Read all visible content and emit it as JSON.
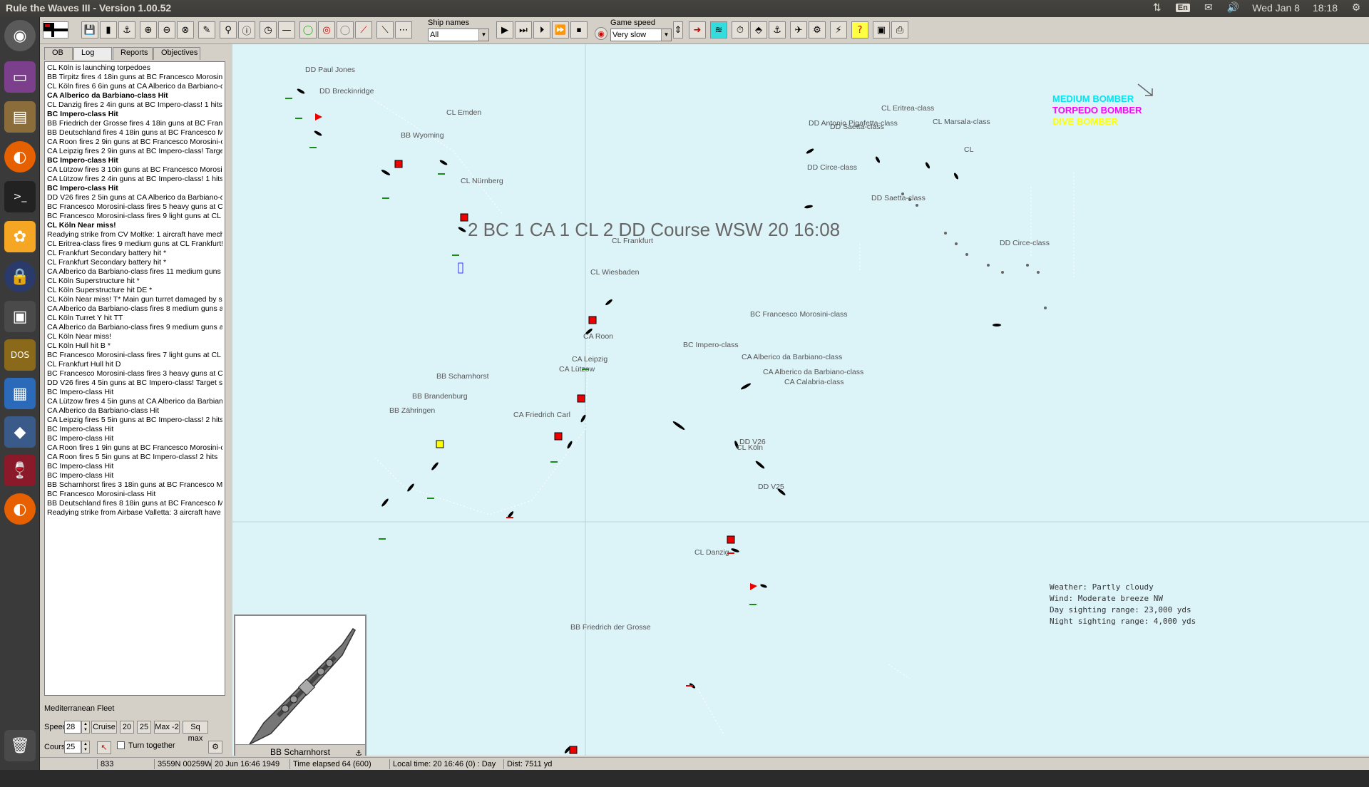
{
  "panel": {
    "title": "Rule the Waves III - Version 1.00.52",
    "lang": "En",
    "date": "Wed Jan 8",
    "time": "18:18"
  },
  "launcher": {
    "items": [
      "dash-home",
      "files",
      "file-manager",
      "firefox",
      "terminal",
      "app-store",
      "lock",
      "window",
      "dosbox",
      "writer",
      "virtualbox",
      "wine",
      "firefox-2",
      "trash"
    ]
  },
  "toolbar": {
    "ship_names_label": "Ship names",
    "ship_names_value": "All",
    "game_speed_label": "Game speed",
    "game_speed_value": "Very slow"
  },
  "tabs": [
    "OB",
    "Log",
    "Reports",
    "Objectives"
  ],
  "log": [
    {
      "t": "CL Köln is launching torpedoes",
      "b": false
    },
    {
      "t": "BB Tirpitz fires 4 18in guns at BC Francesco Morosini",
      "b": false
    },
    {
      "t": "CL Köln fires 6 6in guns at CA Alberico da Barbiano-c",
      "b": false
    },
    {
      "t": "CA Alberico da Barbiano-class Hit",
      "b": true
    },
    {
      "t": "CL Danzig fires 2 4in guns at BC Impero-class! 1 hits",
      "b": false
    },
    {
      "t": "BC Impero-class Hit",
      "b": true
    },
    {
      "t": "BB Friedrich der Grosse fires 4 18in guns at BC Franc",
      "b": false
    },
    {
      "t": "BB Deutschland fires 4 18in guns at BC Francesco M",
      "b": false
    },
    {
      "t": "CA Roon fires 2 9in guns at BC Francesco Morosini-c",
      "b": false
    },
    {
      "t": "CA Leipzig fires 2 9in guns at BC Impero-class! Targe",
      "b": false
    },
    {
      "t": "BC Impero-class Hit",
      "b": true
    },
    {
      "t": "CA Lützow fires 3 10in guns at BC Francesco Morosi",
      "b": false
    },
    {
      "t": "CA Lützow fires 2 4in guns at BC Impero-class! 1 hits",
      "b": false
    },
    {
      "t": "BC Impero-class Hit",
      "b": true
    },
    {
      "t": "DD V26 fires 2 5in guns at CA Alberico da Barbiano-c",
      "b": false
    },
    {
      "t": "BC Francesco Morosini-class fires 5 heavy guns at C",
      "b": false
    },
    {
      "t": "BC Francesco Morosini-class fires 9 light guns at CL I",
      "b": false
    },
    {
      "t": "CL Köln Near miss!",
      "b": true
    },
    {
      "t": "Readying strike from CV Moltke: 1 aircraft have mech",
      "b": false
    },
    {
      "t": "CL Eritrea-class fires 9 medium guns at CL Frankfurt!",
      "b": false
    },
    {
      "t": "CL Frankfurt Secondary battery hit *",
      "b": false
    },
    {
      "t": "CL Frankfurt Secondary battery hit *",
      "b": false
    },
    {
      "t": "CA Alberico da Barbiano-class fires 11 medium guns",
      "b": false
    },
    {
      "t": "CL Köln Superstructure hit *",
      "b": false
    },
    {
      "t": "CL Köln Superstructure hit DE *",
      "b": false
    },
    {
      "t": "CL Köln Near miss! T* Main gun turret damaged by sp",
      "b": false
    },
    {
      "t": "CA Alberico da Barbiano-class fires 8 medium guns at",
      "b": false
    },
    {
      "t": "CL Köln Turret Y hit TT",
      "b": false
    },
    {
      "t": "CA Alberico da Barbiano-class fires 9 medium guns at",
      "b": false
    },
    {
      "t": "CL Köln Near miss!",
      "b": false
    },
    {
      "t": "CL Köln Hull hit B *",
      "b": false
    },
    {
      "t": "BC Francesco Morosini-class fires 7 light guns at CL F",
      "b": false
    },
    {
      "t": "CL Frankfurt Hull hit D",
      "b": false
    },
    {
      "t": "BC Francesco Morosini-class fires 3 heavy guns at C",
      "b": false
    },
    {
      "t": "DD V26 fires 4 5in guns at BC Impero-class! Target s",
      "b": false
    },
    {
      "t": "BC Impero-class Hit",
      "b": false
    },
    {
      "t": "CA Lützow fires 4 5in guns at CA Alberico da Barbian",
      "b": false
    },
    {
      "t": "CA Alberico da Barbiano-class Hit",
      "b": false
    },
    {
      "t": "CA Leipzig fires 5 5in guns at BC Impero-class! 2 hits",
      "b": false
    },
    {
      "t": "BC Impero-class Hit",
      "b": false
    },
    {
      "t": "BC Impero-class Hit",
      "b": false
    },
    {
      "t": "CA Roon fires 1 9in guns at BC Francesco Morosini-c",
      "b": false
    },
    {
      "t": "CA Roon fires 5 5in guns at BC Impero-class! 2 hits",
      "b": false
    },
    {
      "t": "BC Impero-class Hit",
      "b": false
    },
    {
      "t": "BC Impero-class Hit",
      "b": false
    },
    {
      "t": "BB Scharnhorst fires 3 18in guns at BC Francesco M",
      "b": false
    },
    {
      "t": "BC Francesco Morosini-class Hit",
      "b": false
    },
    {
      "t": "BB Deutschland fires 8 18in guns at BC Francesco M",
      "b": false
    },
    {
      "t": "Readying strike from Airbase Valletta: 3 aircraft have",
      "b": false
    }
  ],
  "fleet": {
    "name": "Mediterranean Fleet",
    "speed_label": "Speed",
    "speed_value": "28",
    "cruise": "Cruise",
    "s20": "20",
    "s25": "25",
    "max2": "Max -2",
    "sqmax": "Sq max",
    "course_label": "Course",
    "course_value": "25",
    "turn_together": "Turn together"
  },
  "map": {
    "group_info": "2 BC 1 CA 1 CL 2 DD Course WSW 20 16:08",
    "legend": [
      {
        "label": "MEDIUM BOMBER",
        "color": "#00e5f0"
      },
      {
        "label": "TORPEDO BOMBER",
        "color": "#ff00ff"
      },
      {
        "label": "DIVE BOMBER",
        "color": "#ffff00"
      }
    ],
    "weather": [
      "Weather: Partly cloudy",
      "Wind: Moderate breeze  NW",
      "Day sighting range: 23,000 yds",
      "Night sighting range: 4,000 yds"
    ],
    "labels": [
      "DD Paul Jones",
      "DD Breckinridge",
      "BB Wyoming",
      "CL Emden",
      "CL Nürnberg",
      "CL Frankfurt",
      "CL Wiesbaden",
      "CA Roon",
      "CA Leipzig",
      "CA Lützow",
      "BB Scharnhorst",
      "BB Brandenburg",
      "BB Zähringen",
      "CA Friedrich Carl",
      "DD V26",
      "CL Köln",
      "DD V25",
      "CL Danzig",
      "BB Friedrich der Grosse",
      "BC Francesco Morosini-class",
      "BC Impero-class",
      "CA Alberico da Barbiano-class",
      "CA Alberico da Barbiano-class",
      "CA Calabria-class",
      "CL Eritrea-class",
      "CL Marsala-class",
      "DD Antonio Pigafetta-class",
      "DD Saetta-class",
      "CL",
      "DD Circe-class",
      "DD Saetta-class",
      "DD Circe-class"
    ]
  },
  "preview": {
    "name": "BB Scharnhorst"
  },
  "status": {
    "s1": "833",
    "s2": "3559N 00259W",
    "s3": "20 Jun 16:46 1949",
    "s4": "Time elapsed 64 (600)",
    "s5": "Local time: 20 16:46 (0) : Day",
    "s6": "Dist: 7511 yd"
  }
}
